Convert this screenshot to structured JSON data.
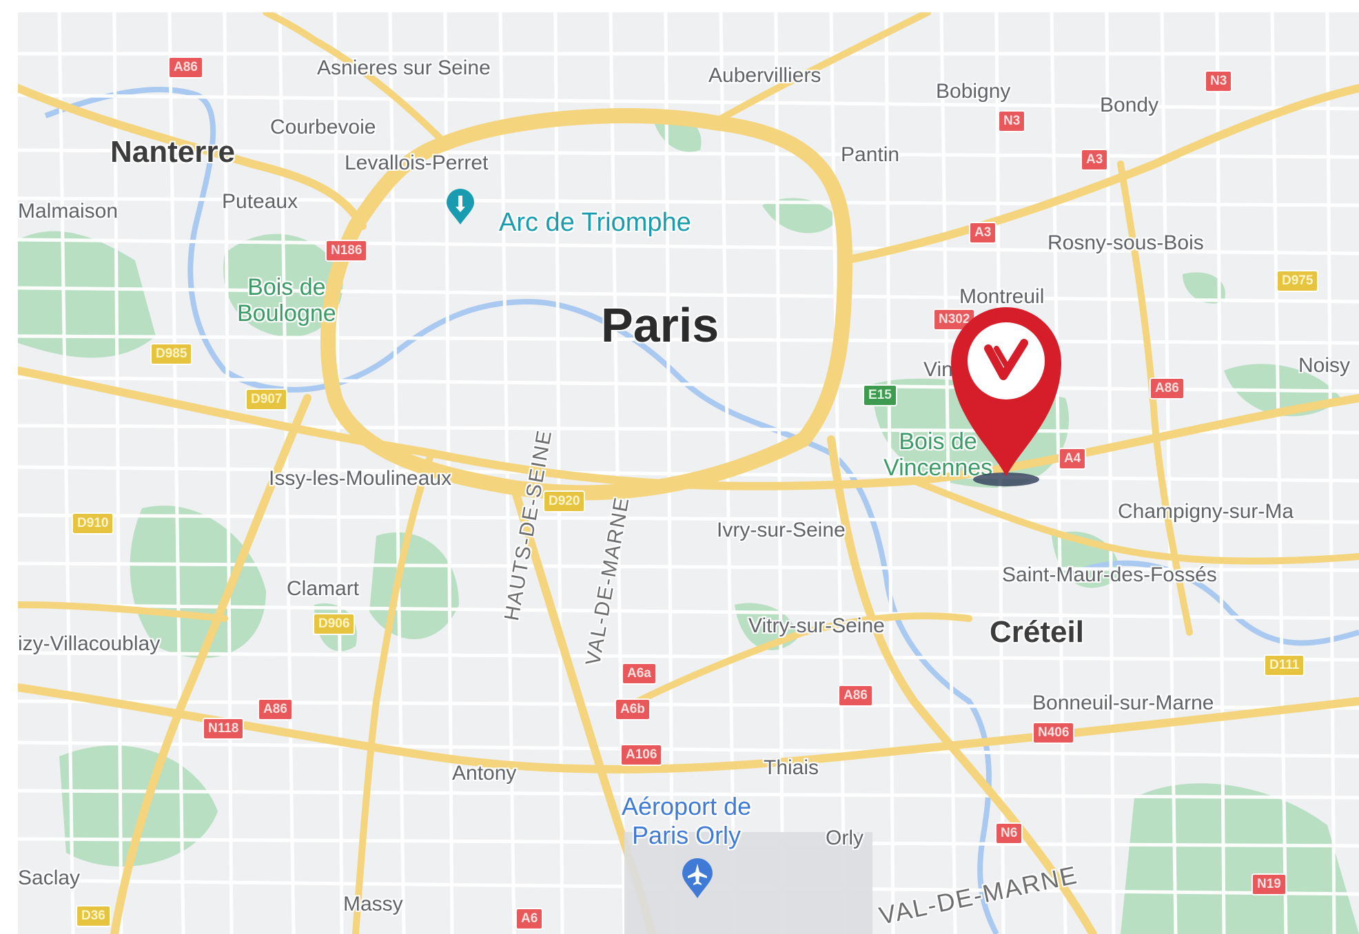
{
  "colors": {
    "land": "#eef0f2",
    "park": "#b9dfc2",
    "road_major": "#f4d47d",
    "road_minor": "#ffffff",
    "water": "#a9c9f0",
    "marker_red": "#d61e2b",
    "poi_teal": "#1a9cb0"
  },
  "map": {
    "center_city": "Paris",
    "places": [
      {
        "id": "nanterre",
        "text": "Nanterre",
        "style": "big"
      },
      {
        "id": "asnieres",
        "text": "Asnieres sur Seine",
        "style": "small"
      },
      {
        "id": "aubervilliers",
        "text": "Aubervilliers",
        "style": "small"
      },
      {
        "id": "bobigny",
        "text": "Bobigny",
        "style": "small"
      },
      {
        "id": "bondy",
        "text": "Bondy",
        "style": "small"
      },
      {
        "id": "courbevoie",
        "text": "Courbevoie",
        "style": "small"
      },
      {
        "id": "levallois",
        "text": "Levallois-Perret",
        "style": "small"
      },
      {
        "id": "pantin",
        "text": "Pantin",
        "style": "small"
      },
      {
        "id": "malmaison",
        "text": "Malmaison",
        "style": "small"
      },
      {
        "id": "puteaux",
        "text": "Puteaux",
        "style": "small"
      },
      {
        "id": "rosny",
        "text": "Rosny-sous-Bois",
        "style": "small"
      },
      {
        "id": "montreuil",
        "text": "Montreuil",
        "style": "small"
      },
      {
        "id": "noisy",
        "text": "Noisy",
        "style": "small"
      },
      {
        "id": "vin",
        "text": "Vin",
        "style": "small"
      },
      {
        "id": "issy",
        "text": "Issy-les-Moulineaux",
        "style": "small"
      },
      {
        "id": "champigny",
        "text": "Champigny-sur-Ma",
        "style": "small"
      },
      {
        "id": "ivry",
        "text": "Ivry-sur-Seine",
        "style": "small"
      },
      {
        "id": "stmaur",
        "text": "Saint-Maur-des-Fossés",
        "style": "small"
      },
      {
        "id": "clamart",
        "text": "Clamart",
        "style": "small"
      },
      {
        "id": "vitry",
        "text": "Vitry-sur-Seine",
        "style": "small"
      },
      {
        "id": "creteil",
        "text": "Créteil",
        "style": "big"
      },
      {
        "id": "velizy",
        "text": "izy-Villacoublay",
        "style": "small"
      },
      {
        "id": "bonneuil",
        "text": "Bonneuil-sur-Marne",
        "style": "small"
      },
      {
        "id": "antony",
        "text": "Antony",
        "style": "small"
      },
      {
        "id": "thiais",
        "text": "Thiais",
        "style": "small"
      },
      {
        "id": "orly",
        "text": "Orly",
        "style": "small"
      },
      {
        "id": "saclay",
        "text": "Saclay",
        "style": "small"
      },
      {
        "id": "massy",
        "text": "Massy",
        "style": "small"
      }
    ],
    "parks": [
      {
        "id": "boulogne",
        "text": "Bois de\nBoulogne"
      },
      {
        "id": "vincennes",
        "text": "Bois de\nVincennes"
      }
    ],
    "pois": [
      {
        "id": "arc",
        "text": "Arc de Triomphe",
        "icon": "monument-pin-icon"
      },
      {
        "id": "orly-airport",
        "text": "Aéroport de\nParis Orly",
        "icon": "airport-pin-icon"
      }
    ],
    "departments": [
      {
        "id": "hauts-de-seine",
        "text": "HAUTS-DE-SEINE"
      },
      {
        "id": "val-de-marne-v",
        "text": "VAL-DE-MARNE"
      },
      {
        "id": "val-de-marne-h",
        "text": "VAL-DE-MARNE"
      }
    ],
    "shields": [
      {
        "id": "s1",
        "text": "A86",
        "kind": "r"
      },
      {
        "id": "s2",
        "text": "N3",
        "kind": "r"
      },
      {
        "id": "s3",
        "text": "N3",
        "kind": "r"
      },
      {
        "id": "s4",
        "text": "A3",
        "kind": "r"
      },
      {
        "id": "s5",
        "text": "A3",
        "kind": "r"
      },
      {
        "id": "s6",
        "text": "N186",
        "kind": "r"
      },
      {
        "id": "s7",
        "text": "D975",
        "kind": "y"
      },
      {
        "id": "s8",
        "text": "D985",
        "kind": "y"
      },
      {
        "id": "s9",
        "text": "N302",
        "kind": "r"
      },
      {
        "id": "s10",
        "text": "D907",
        "kind": "y"
      },
      {
        "id": "s11",
        "text": "E15",
        "kind": "g"
      },
      {
        "id": "s12",
        "text": "A86",
        "kind": "r"
      },
      {
        "id": "s13",
        "text": "A4",
        "kind": "r"
      },
      {
        "id": "s14",
        "text": "D910",
        "kind": "y"
      },
      {
        "id": "s15",
        "text": "D920",
        "kind": "y"
      },
      {
        "id": "s16",
        "text": "D906",
        "kind": "y"
      },
      {
        "id": "s17",
        "text": "A6a",
        "kind": "r"
      },
      {
        "id": "s18",
        "text": "A6b",
        "kind": "r"
      },
      {
        "id": "s19",
        "text": "A86",
        "kind": "r"
      },
      {
        "id": "s20",
        "text": "D111",
        "kind": "y"
      },
      {
        "id": "s21",
        "text": "A86",
        "kind": "r"
      },
      {
        "id": "s22",
        "text": "N118",
        "kind": "r"
      },
      {
        "id": "s23",
        "text": "N406",
        "kind": "r"
      },
      {
        "id": "s24",
        "text": "A106",
        "kind": "r"
      },
      {
        "id": "s25",
        "text": "N6",
        "kind": "r"
      },
      {
        "id": "s26",
        "text": "N19",
        "kind": "r"
      },
      {
        "id": "s27",
        "text": "D36",
        "kind": "y"
      },
      {
        "id": "s28",
        "text": "A6",
        "kind": "r"
      }
    ],
    "marker": {
      "icon": "location-pin-heart-icon"
    }
  }
}
